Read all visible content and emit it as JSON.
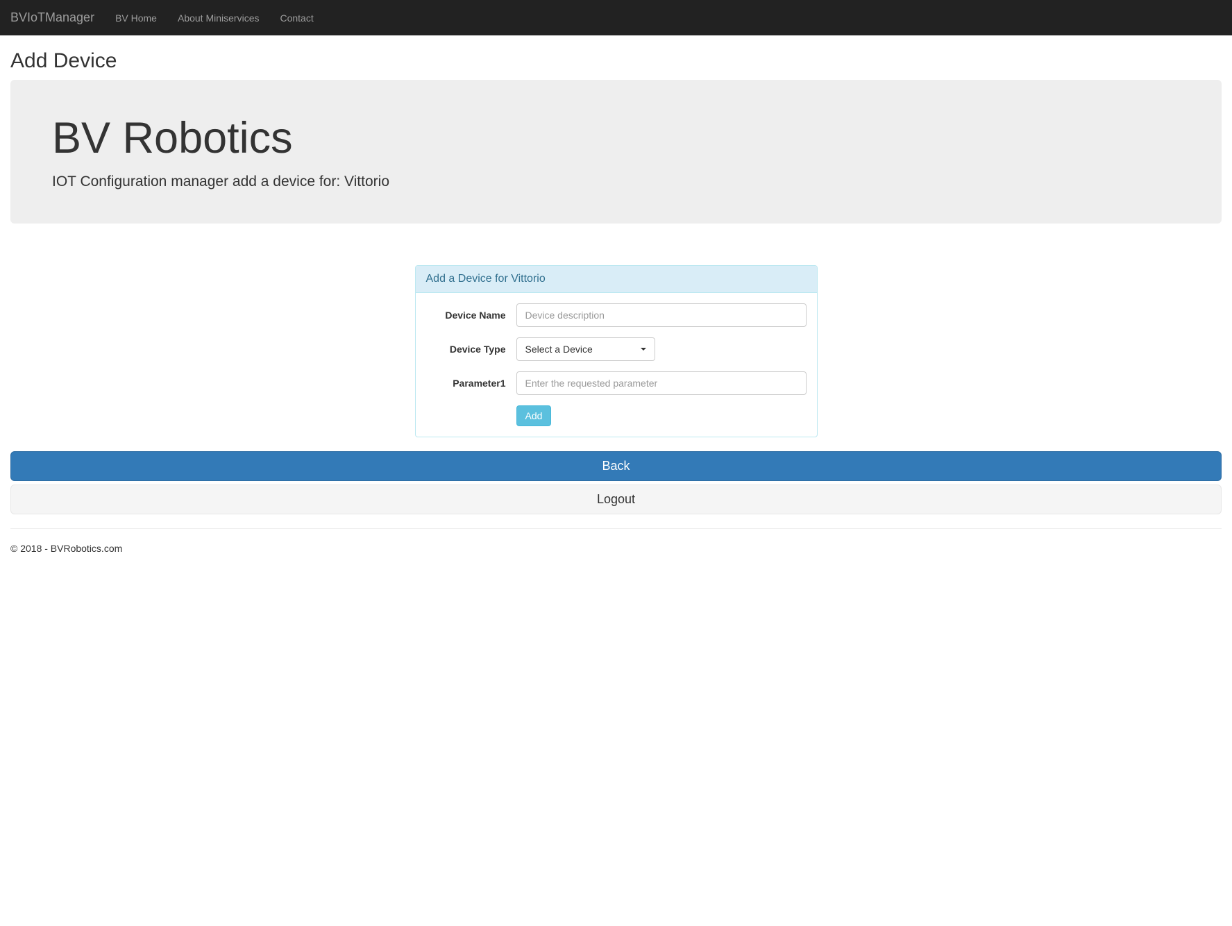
{
  "navbar": {
    "brand": "BVIoTManager",
    "items": [
      {
        "label": "BV Home"
      },
      {
        "label": "About Miniservices"
      },
      {
        "label": "Contact"
      }
    ]
  },
  "page": {
    "title": "Add Device"
  },
  "jumbotron": {
    "heading": "BV Robotics",
    "lead": "IOT Configuration manager add a device for: Vittorio"
  },
  "panel": {
    "heading": "Add a Device for Vittorio"
  },
  "form": {
    "deviceName": {
      "label": "Device Name",
      "placeholder": "Device description",
      "value": ""
    },
    "deviceType": {
      "label": "Device Type",
      "selected": "Select a Device"
    },
    "parameter1": {
      "label": "Parameter1",
      "placeholder": "Enter the requested parameter",
      "value": ""
    },
    "submit": "Add"
  },
  "actions": {
    "back": "Back",
    "logout": "Logout"
  },
  "footer": {
    "text": "© 2018 - BVRobotics.com"
  }
}
